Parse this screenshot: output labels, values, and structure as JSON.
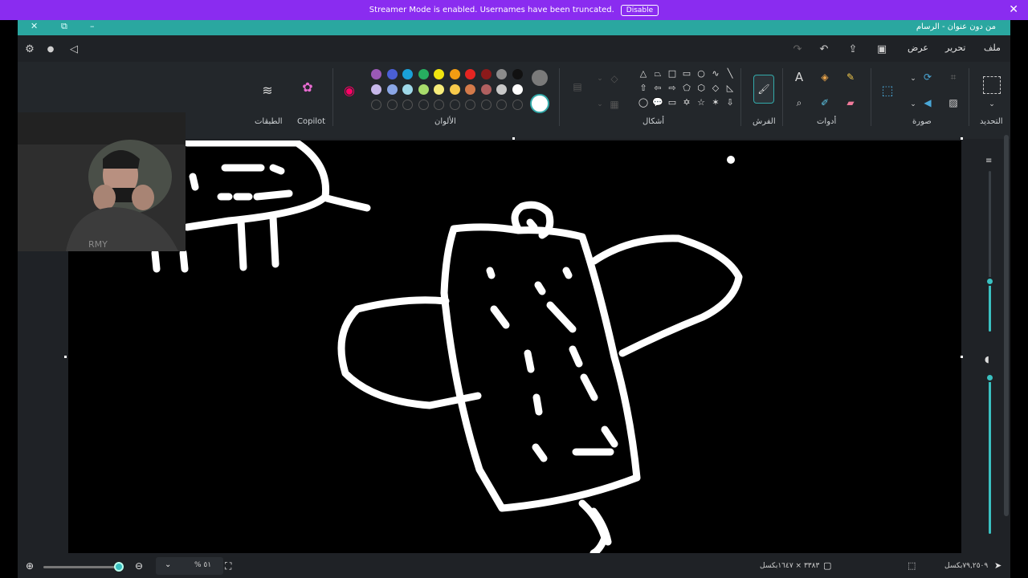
{
  "banner": {
    "message": "Streamer Mode is enabled. Usernames have been truncated.",
    "disable_label": "Disable"
  },
  "window": {
    "title": "من دون عنوان - الرسام"
  },
  "menu": {
    "file": "ملف",
    "edit": "تحرير",
    "view": "عرض"
  },
  "ribbon": {
    "groups": {
      "selection": "التحديد",
      "image": "صورة",
      "tools": "أدوات",
      "brushes": "الفرش",
      "shapes": "أشكال",
      "colors": "الألوان",
      "copilot": "Copilot",
      "layers": "الطبقات"
    },
    "colors_row1": [
      "#9b59b6",
      "#4a5fd6",
      "#1aa0d8",
      "#27ae60",
      "#f1e40f",
      "#f39c12",
      "#e52521",
      "#8b1a1a",
      "#8c8c8c",
      "#111111"
    ],
    "colors_row2": [
      "#c7b8ea",
      "#8aa6e6",
      "#9fd8e8",
      "#a8dc6c",
      "#f6ec7a",
      "#f7c94b",
      "#d37a4a",
      "#b06060",
      "#c9c9c9",
      "#ffffff"
    ],
    "primary_color": "#7a7a7a",
    "secondary_color": "#ffffff"
  },
  "status": {
    "position": "٧٩,٢٥٠٩بكسل",
    "canvas_size": "٣٣٨٣ × ١٦٤٧بكسل",
    "zoom": "٥١ %"
  }
}
